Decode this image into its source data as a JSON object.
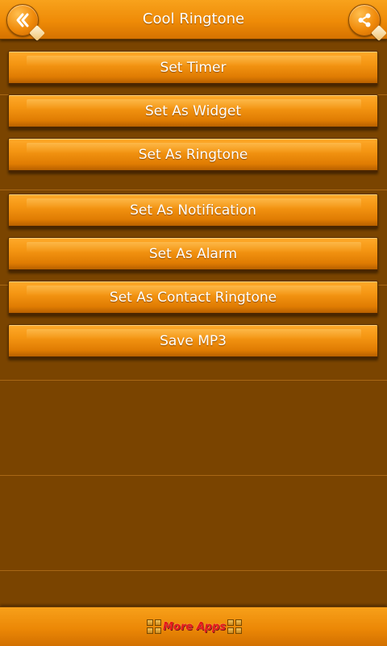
{
  "app": {
    "title": "Cool Ringtone"
  },
  "menu": {
    "items": [
      {
        "label": "Set Timer"
      },
      {
        "label": "Set As Widget"
      },
      {
        "label": "Set As Ringtone"
      },
      {
        "label": "Set As Notification"
      },
      {
        "label": "Set As Alarm"
      },
      {
        "label": "Set As Contact Ringtone"
      },
      {
        "label": "Save MP3"
      }
    ]
  },
  "footer": {
    "more_apps_label": "More Apps"
  },
  "icons": {
    "back": "double-chevron-left-icon",
    "share": "share-icon"
  },
  "colors": {
    "background": "#7a4400",
    "bar": "#ef8b07",
    "button": "#f49512",
    "text": "#ffffff",
    "more_apps_text": "#e81818"
  }
}
